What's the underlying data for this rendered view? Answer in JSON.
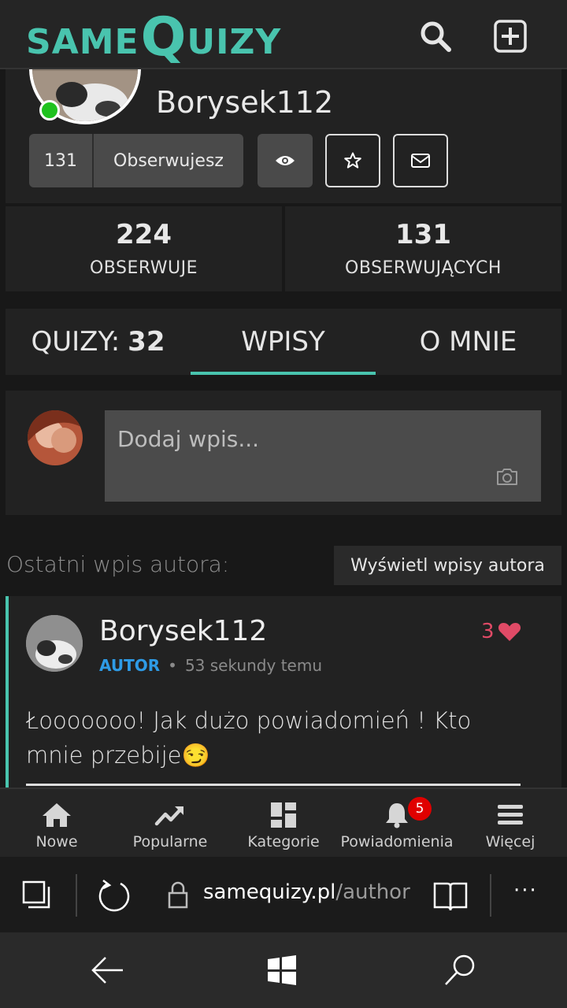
{
  "header": {
    "logo": {
      "part1": "SAME",
      "part2": "Q",
      "part3": "UIZY"
    },
    "icons": [
      "search-icon",
      "add-square-icon"
    ]
  },
  "profile": {
    "username": "Borysek112",
    "followers_count_btn": "131",
    "follow_label": "Obserwujesz",
    "online_color": "#1fc21f"
  },
  "stats": [
    {
      "value": "224",
      "label": "OBSERWUJE"
    },
    {
      "value": "131",
      "label": "OBSERWUJĄCYCH"
    }
  ],
  "tabs": {
    "quizzes_label": "QUIZY:",
    "quizzes_count": "32",
    "posts_label": "WPISY",
    "about_label": "O MNIE",
    "active": "WPISY"
  },
  "composer": {
    "placeholder": "Dodaj wpis..."
  },
  "latest": {
    "label": "Ostatni wpis autora:",
    "button": "Wyświetl wpisy autora"
  },
  "post": {
    "author": "Borysek112",
    "badge": "AUTOR",
    "separator": "•",
    "time": "53 sekundy temu",
    "likes": "3",
    "text": "Łooooooo! Jak dużo powiadomień ! Kto mnie przebije",
    "emoji": "😏"
  },
  "bottom_nav": [
    {
      "label": "Nowe",
      "icon": "home-icon"
    },
    {
      "label": "Popularne",
      "icon": "trending-icon"
    },
    {
      "label": "Kategorie",
      "icon": "grid-icon"
    },
    {
      "label": "Powiadomienia",
      "icon": "bell-icon",
      "badge": "5"
    },
    {
      "label": "Więcej",
      "icon": "menu-icon"
    }
  ],
  "browser": {
    "domain": "samequizy.pl",
    "path": "/author",
    "more": "···"
  },
  "colors": {
    "accent": "#49c4ae",
    "author_badge": "#2e9be6",
    "like": "#e04a66",
    "notification": "#e00000"
  }
}
